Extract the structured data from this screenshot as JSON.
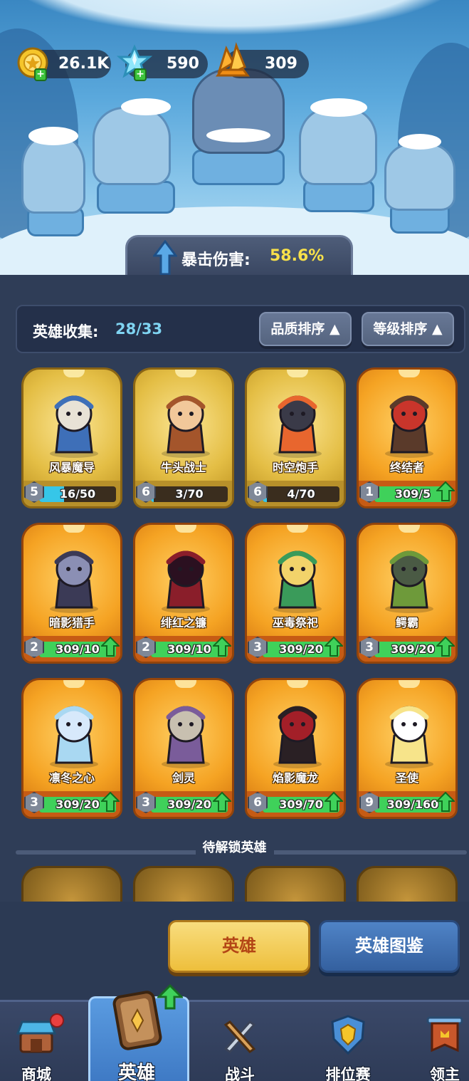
{
  "currencies": [
    {
      "name": "gold",
      "value": "26.1K",
      "color": "#f5c52b",
      "icon": "gold-coin-icon"
    },
    {
      "name": "crystal",
      "value": "590",
      "color": "#7fe0f5",
      "icon": "ice-crystal-icon"
    },
    {
      "name": "gem",
      "value": "309",
      "color": "#ffb030",
      "icon": "orange-gem-icon"
    }
  ],
  "crit": {
    "label": "暴击伤害:",
    "value": "58.6%"
  },
  "collection": {
    "label": "英雄收集:",
    "count": "28/33"
  },
  "sort": {
    "quality": "品质排序",
    "level": "等级排序"
  },
  "heroes": [
    {
      "name": "风暴魔导",
      "level": "5",
      "progress": "16/50",
      "fill": 0.32,
      "rarity": "gold",
      "upgradable": false,
      "icon": "wizard-icon"
    },
    {
      "name": "牛头战士",
      "level": "6",
      "progress": "3/70",
      "fill": 0.04,
      "rarity": "gold",
      "upgradable": false,
      "icon": "minotaur-icon"
    },
    {
      "name": "时空炮手",
      "level": "6",
      "progress": "4/70",
      "fill": 0.06,
      "rarity": "gold",
      "upgradable": false,
      "icon": "gunner-icon"
    },
    {
      "name": "终结者",
      "level": "1",
      "progress": "309/5",
      "fill": 1,
      "rarity": "orange",
      "upgradable": true,
      "icon": "terminator-icon"
    },
    {
      "name": "暗影猎手",
      "level": "2",
      "progress": "309/10",
      "fill": 1,
      "rarity": "orange",
      "upgradable": true,
      "icon": "shadow-hunter-icon"
    },
    {
      "name": "绯红之镰",
      "level": "2",
      "progress": "309/10",
      "fill": 1,
      "rarity": "orange",
      "upgradable": true,
      "icon": "crimson-scythe-icon"
    },
    {
      "name": "巫毒祭祀",
      "level": "3",
      "progress": "309/20",
      "fill": 1,
      "rarity": "orange",
      "upgradable": true,
      "icon": "voodoo-priest-icon"
    },
    {
      "name": "鳄霸",
      "level": "3",
      "progress": "309/20",
      "fill": 1,
      "rarity": "orange",
      "upgradable": true,
      "icon": "crocodile-icon"
    },
    {
      "name": "凛冬之心",
      "level": "3",
      "progress": "309/20",
      "fill": 1,
      "rarity": "orange",
      "upgradable": true,
      "icon": "ice-queen-icon"
    },
    {
      "name": "剑灵",
      "level": "3",
      "progress": "309/20",
      "fill": 1,
      "rarity": "orange",
      "upgradable": true,
      "icon": "sword-spirit-icon"
    },
    {
      "name": "焰影魔龙",
      "level": "6",
      "progress": "309/70",
      "fill": 1,
      "rarity": "orange",
      "upgradable": true,
      "icon": "dragon-icon"
    },
    {
      "name": "圣使",
      "level": "9",
      "progress": "309/160",
      "fill": 1,
      "rarity": "orange",
      "upgradable": true,
      "icon": "angel-icon"
    }
  ],
  "locked": {
    "title": "待解锁英雄"
  },
  "buttons": {
    "hero": "英雄",
    "atlas": "英雄图鉴"
  },
  "nav": [
    {
      "label": "商城",
      "icon": "shop-icon",
      "active": false
    },
    {
      "label": "英雄",
      "icon": "hero-card-icon",
      "active": true
    },
    {
      "label": "战斗",
      "icon": "crossed-swords-icon",
      "active": false
    },
    {
      "label": "排位赛",
      "icon": "rank-shield-icon",
      "active": false
    },
    {
      "label": "领主",
      "icon": "banner-icon",
      "active": false
    }
  ],
  "colors": {
    "accent_gold": "#f7e04a",
    "progress_green": "#3fd15a",
    "progress_cyan": "#36c6e8"
  }
}
